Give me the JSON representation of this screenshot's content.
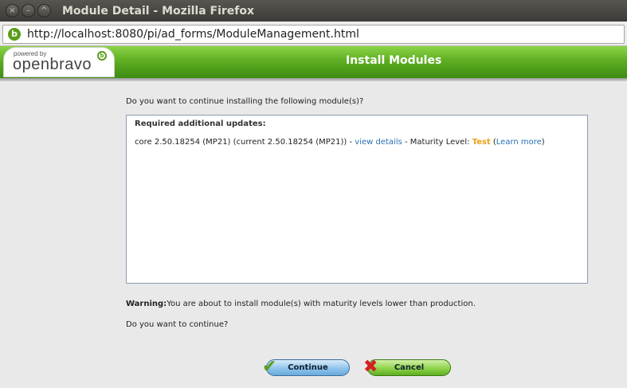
{
  "window": {
    "title": "Module Detail - Mozilla Firefox",
    "controls": [
      "×",
      "–",
      "^"
    ]
  },
  "browser": {
    "url": "http://localhost:8080/pi/ad_forms/ModuleManagement.html",
    "site_icon": "b"
  },
  "header": {
    "logo_small": "powered by",
    "logo_main": "openbravo",
    "logo_badge": "b",
    "title": "Install Modules"
  },
  "content": {
    "question": "Do you want to continue installing the following module(s)?",
    "required_title": "Required additional updates:",
    "module": {
      "prefix": "core 2.50.18254 (MP21) (current 2.50.18254 (MP21)) - ",
      "details_link": "view details",
      "maturity_label": " - Maturity Level: ",
      "maturity_value": "Test",
      "learn_open": " (",
      "learn_more": "Learn more",
      "learn_close": ")"
    },
    "warning_label": "Warning:",
    "warning_text": "You are about to install module(s) with maturity levels lower than production.",
    "confirm": "Do you want to continue?"
  },
  "buttons": {
    "continue_label": "Continue",
    "continue_icon": "✔",
    "cancel_label": "Cancel",
    "cancel_icon": "✖"
  },
  "colors": {
    "header_green": "#5fae22",
    "link_blue": "#2a6fb6",
    "maturity_orange": "#e8a21a"
  }
}
